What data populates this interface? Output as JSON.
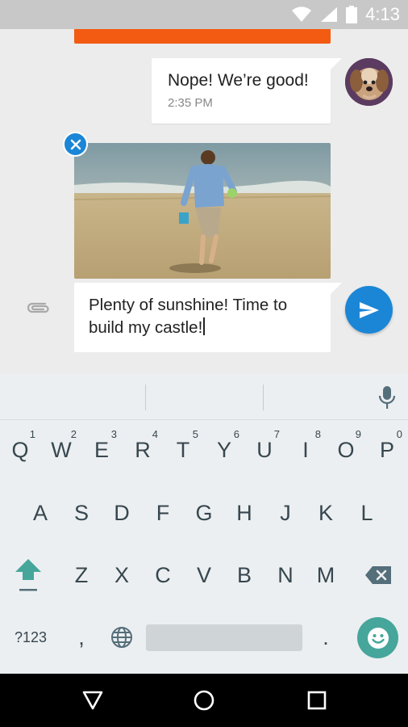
{
  "status_bar": {
    "time": "4:13",
    "icons": [
      "wifi-icon",
      "cellular-icon",
      "battery-icon"
    ]
  },
  "conversation": {
    "messages": [
      {
        "text": "Nope! We’re good!",
        "time": "2:35 PM",
        "sender": "self"
      }
    ],
    "attachment": {
      "type": "image",
      "description_icon": "beach-photo"
    },
    "compose": {
      "text": "Plenty of sunshine! Time to build my castle!"
    }
  },
  "keyboard": {
    "row1": [
      {
        "label": "Q",
        "hint": "1"
      },
      {
        "label": "W",
        "hint": "2"
      },
      {
        "label": "E",
        "hint": "3"
      },
      {
        "label": "R",
        "hint": "4"
      },
      {
        "label": "T",
        "hint": "5"
      },
      {
        "label": "Y",
        "hint": "6"
      },
      {
        "label": "U",
        "hint": "7"
      },
      {
        "label": "I",
        "hint": "8"
      },
      {
        "label": "O",
        "hint": "9"
      },
      {
        "label": "P",
        "hint": "0"
      }
    ],
    "row2": [
      "A",
      "S",
      "D",
      "F",
      "G",
      "H",
      "J",
      "K",
      "L"
    ],
    "row3": [
      "Z",
      "X",
      "C",
      "V",
      "B",
      "N",
      "M"
    ],
    "symbols_label": "?123",
    "comma": ",",
    "period": "."
  },
  "colors": {
    "accent": "#1b86d6",
    "previous_bubble": "#f35b12",
    "emoji_button": "#46a69b",
    "shift_arrow": "#46a69b",
    "keyboard_bg": "#eceff1"
  }
}
